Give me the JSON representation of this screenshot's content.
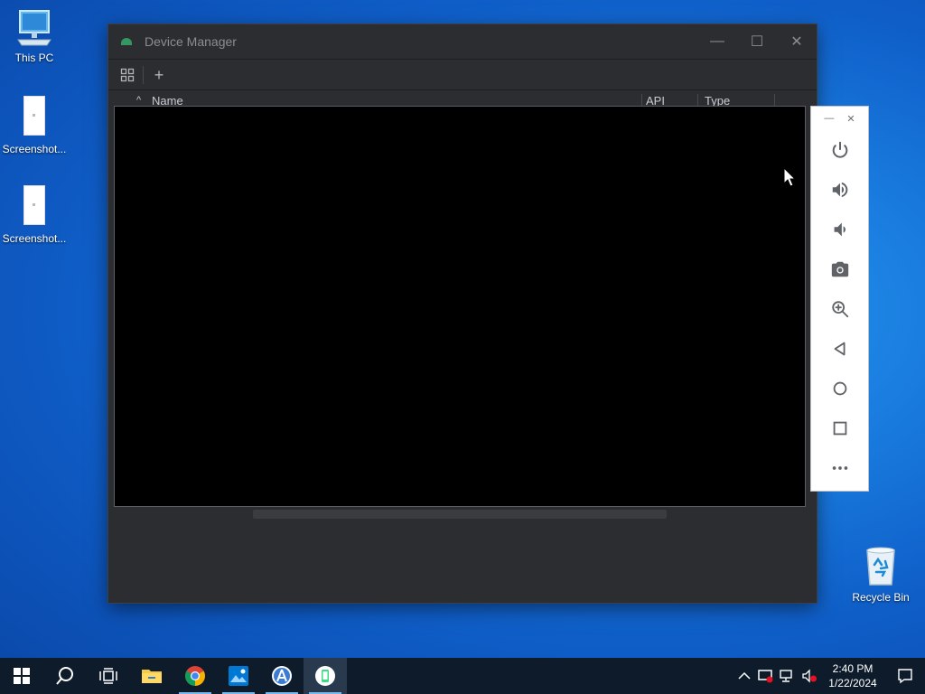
{
  "desktop": {
    "icons": [
      {
        "label": "This PC"
      },
      {
        "label": "Screenshot..."
      },
      {
        "label": "Screenshot..."
      }
    ],
    "recycle_bin": {
      "label": "Recycle Bin"
    }
  },
  "device_manager": {
    "title": "Device Manager",
    "window_buttons": {
      "minimize": "—",
      "maximize": "☐",
      "close": "✕"
    },
    "toolbar": {
      "add": "+"
    },
    "columns": [
      "Name",
      "API",
      "Type"
    ],
    "sort_indicator": "^"
  },
  "emulator_panel": {
    "top": {
      "minimize": "—",
      "close": "✕"
    },
    "buttons": [
      "power-icon",
      "volume-up-icon",
      "volume-down-icon",
      "camera-icon",
      "zoom-icon",
      "back-icon",
      "home-icon",
      "overview-icon",
      "more-icon"
    ]
  },
  "taskbar": {
    "clock_time": "2:40 PM",
    "clock_date": "1/22/2024"
  }
}
